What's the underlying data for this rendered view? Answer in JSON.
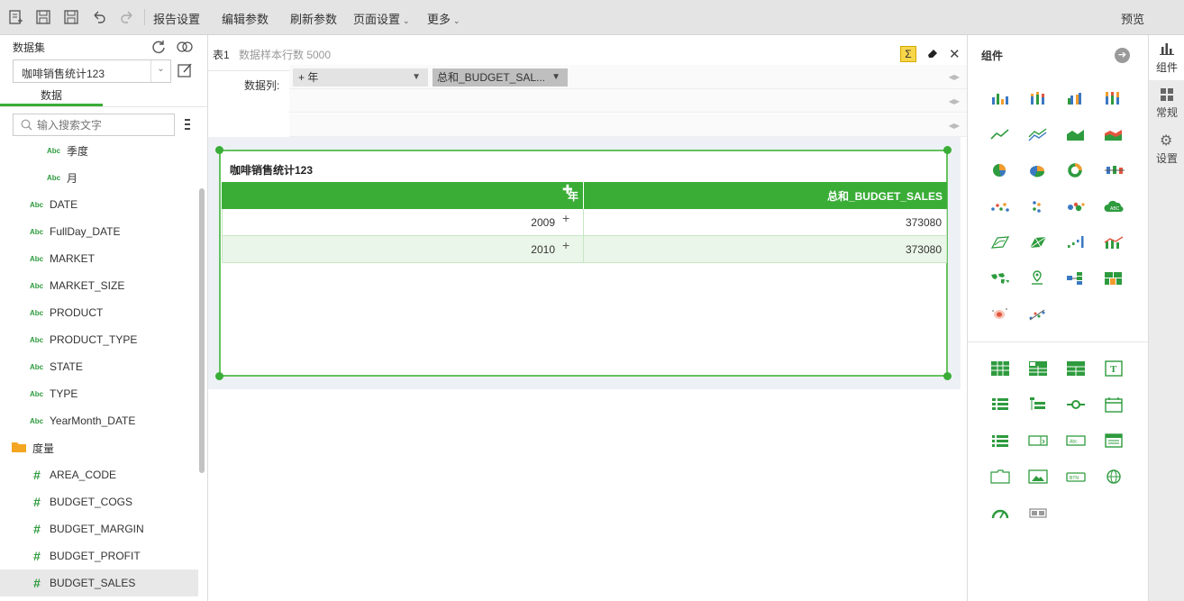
{
  "toolbar": {
    "report_settings": "报告设置",
    "edit_params": "编辑参数",
    "refresh_params": "刷新参数",
    "page_settings": "页面设置",
    "more": "更多",
    "preview": "预览"
  },
  "left_panel": {
    "title": "数据集",
    "dataset_name": "咖啡销售统计123",
    "tab_label": "数据",
    "search_placeholder": "输入搜索文字",
    "dimension_children": [
      {
        "type": "Abc",
        "label": "季度"
      },
      {
        "type": "Abc",
        "label": "月"
      }
    ],
    "dimensions": [
      {
        "type": "Abc",
        "label": "DATE"
      },
      {
        "type": "Abc",
        "label": "FullDay_DATE"
      },
      {
        "type": "Abc",
        "label": "MARKET"
      },
      {
        "type": "Abc",
        "label": "MARKET_SIZE"
      },
      {
        "type": "Abc",
        "label": "PRODUCT"
      },
      {
        "type": "Abc",
        "label": "PRODUCT_TYPE"
      },
      {
        "type": "Abc",
        "label": "STATE"
      },
      {
        "type": "Abc",
        "label": "TYPE"
      },
      {
        "type": "Abc",
        "label": "YearMonth_DATE"
      }
    ],
    "measure_folder": "度量",
    "measures": [
      {
        "type": "#",
        "label": "AREA_CODE"
      },
      {
        "type": "#",
        "label": "BUDGET_COGS"
      },
      {
        "type": "#",
        "label": "BUDGET_MARGIN"
      },
      {
        "type": "#",
        "label": "BUDGET_PROFIT"
      },
      {
        "type": "#",
        "label": "BUDGET_SALES"
      }
    ]
  },
  "center": {
    "table_tab": "表1",
    "sample_rows": "数据样本行数 5000",
    "data_columns_label": "数据列:",
    "column_chip_1": "+ 年",
    "column_chip_2": "总和_BUDGET_SAL...",
    "table_title": "咖啡销售统计123",
    "headers": [
      "年",
      "总和_BUDGET_SALES"
    ],
    "rows": [
      {
        "year": "2009",
        "value": "373080"
      },
      {
        "year": "2010",
        "value": "373080"
      }
    ]
  },
  "right_panel": {
    "title": "组件"
  },
  "far_right": {
    "components_label": "组件",
    "general_label": "常规",
    "settings_label": "设置"
  },
  "colors": {
    "accent": "#3aad37",
    "row_alt": "#eaf6e9",
    "toolbar_bg": "#e4e4e4"
  }
}
